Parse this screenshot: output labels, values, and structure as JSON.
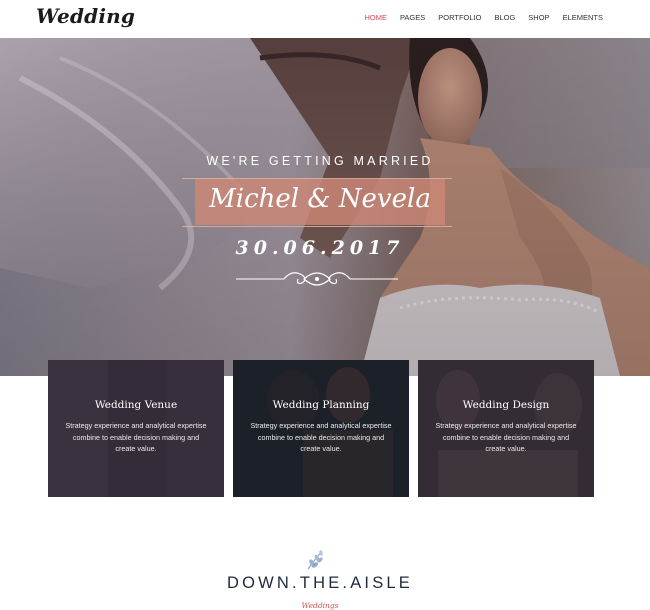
{
  "header": {
    "logo": "Wedding",
    "nav": [
      "HOME",
      "PAGES",
      "PORTFOLIO",
      "BLOG",
      "SHOP",
      "ELEMENTS"
    ],
    "active_index": 0
  },
  "hero": {
    "tagline": "WE'RE GETTING MARRIED",
    "names": "Michel & Nevela",
    "date": "30.06.2017"
  },
  "cards": [
    {
      "title": "Wedding Venue",
      "description": "Strategy experience and analytical expertise combine to enable decision making and create value."
    },
    {
      "title": "Wedding Planning",
      "description": "Strategy experience and analytical expertise combine to enable decision making and create value."
    },
    {
      "title": "Wedding Design",
      "description": "Strategy experience and analytical expertise combine to enable decision making and create value."
    }
  ],
  "section": {
    "title": "DOWN.THE.AISLE",
    "subtitle": "Weddings"
  },
  "colors": {
    "accent": "#d1485f",
    "names_box": "#cc8876",
    "heading": "#1e2a3c",
    "card_overlay": "#2a2430"
  }
}
